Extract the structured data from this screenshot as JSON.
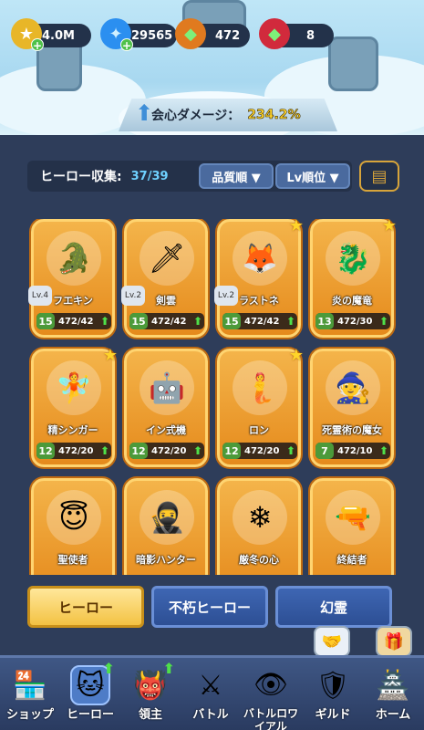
{
  "resources": [
    {
      "icon": "gold-coin-icon",
      "value": "4.0M"
    },
    {
      "icon": "blue-gem-icon",
      "value": "29565"
    },
    {
      "icon": "green-crystal-icon",
      "value": "472"
    },
    {
      "icon": "red-crystal-icon",
      "value": "8"
    }
  ],
  "crit": {
    "label": "会心ダメージ：",
    "value": "234.2%"
  },
  "collection": {
    "label": "ヒーロー収集:",
    "count": "37/39"
  },
  "sort": {
    "quality": "品質順 ▼",
    "level": "Lv順位 ▼"
  },
  "heroes": [
    {
      "name": "フエキン",
      "badge": "Lv.4",
      "level": "15",
      "frag": "472/42",
      "star": false
    },
    {
      "name": "剣雲",
      "badge": "Lv.2",
      "level": "15",
      "frag": "472/42",
      "star": false
    },
    {
      "name": "ラストネ",
      "badge": "Lv.2",
      "level": "15",
      "frag": "472/42",
      "star": true
    },
    {
      "name": "炎の魔竜",
      "badge": "",
      "level": "13",
      "frag": "472/30",
      "star": true
    },
    {
      "name": "精シンガー",
      "badge": "",
      "level": "12",
      "frag": "472/20",
      "star": true
    },
    {
      "name": "イン式機",
      "badge": "",
      "level": "12",
      "frag": "472/20",
      "star": false
    },
    {
      "name": "ロン",
      "badge": "",
      "level": "12",
      "frag": "472/20",
      "star": true
    },
    {
      "name": "死霊術の魔女",
      "badge": "",
      "level": "7",
      "frag": "472/10",
      "star": false
    },
    {
      "name": "聖使者",
      "badge": "",
      "level": "",
      "frag": "",
      "star": false
    },
    {
      "name": "暗影ハンター",
      "badge": "",
      "level": "",
      "frag": "",
      "star": false
    },
    {
      "name": "厳冬の心",
      "badge": "",
      "level": "",
      "frag": "",
      "star": false
    },
    {
      "name": "終結者",
      "badge": "",
      "level": "",
      "frag": "",
      "star": false
    }
  ],
  "tabs": {
    "hero": "ヒーロー",
    "immortal": "不朽ヒーロー",
    "spirit": "幻霊"
  },
  "nav": [
    {
      "label": "ショップ",
      "icon": "shop-icon"
    },
    {
      "label": "ヒーロー",
      "icon": "hero-icon"
    },
    {
      "label": "領主",
      "icon": "lord-icon"
    },
    {
      "label": "バトル",
      "icon": "battle-icon"
    },
    {
      "label": "バトルロワイアル",
      "icon": "battle-royale-icon"
    },
    {
      "label": "ギルド",
      "icon": "guild-icon"
    },
    {
      "label": "ホーム",
      "icon": "home-icon"
    }
  ]
}
